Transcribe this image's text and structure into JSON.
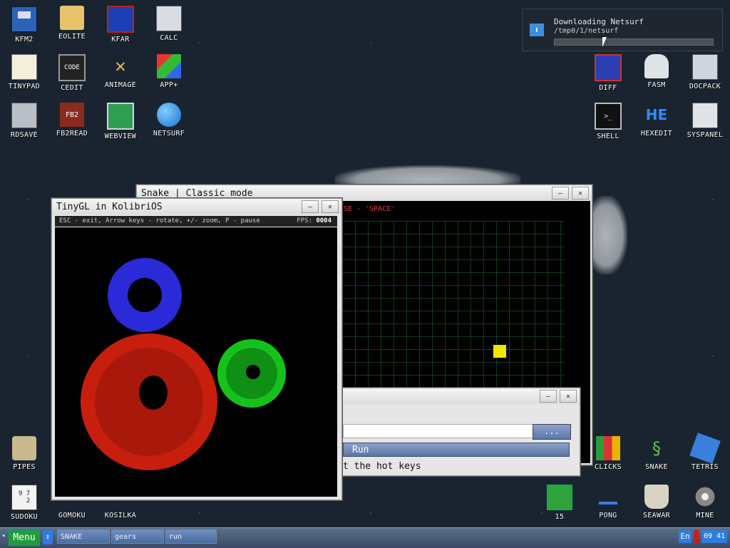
{
  "desktop": {
    "icons": [
      {
        "label": "KFM2"
      },
      {
        "label": "EOLITE"
      },
      {
        "label": "KFAR"
      },
      {
        "label": "CALC"
      },
      {
        "label": "TINYPAD"
      },
      {
        "label": "CEDIT"
      },
      {
        "label": "ANIMAGE"
      },
      {
        "label": "APP+"
      },
      {
        "label": "RDSAVE"
      },
      {
        "label": "FB2READ"
      },
      {
        "label": "WEBVIEW"
      },
      {
        "label": "NETSURF"
      },
      {
        "label": "DIFF"
      },
      {
        "label": "FASM"
      },
      {
        "label": "DOCPACK"
      },
      {
        "label": "SHELL"
      },
      {
        "label": "HEXEDIT"
      },
      {
        "label": "SYSPANEL"
      },
      {
        "label": "PIPES"
      },
      {
        "label": "SUDOKU"
      },
      {
        "label": "GOMOKU"
      },
      {
        "label": "KOSILKA"
      },
      {
        "label": "CLICKS"
      },
      {
        "label": "SNAKE"
      },
      {
        "label": "TETRIS"
      },
      {
        "label": "15"
      },
      {
        "label": "PONG"
      },
      {
        "label": "SEAWAR"
      },
      {
        "label": "MINE"
      }
    ],
    "icon_glyphs": {
      "cedit": "CODE",
      "fb2read": "FB2",
      "hexedit": "HE",
      "sudoku": "9 7\n  2"
    }
  },
  "notification": {
    "title": "Downloading Netsurf",
    "path": "/tmp0/1/netsurf",
    "progress": 0
  },
  "snake_window": {
    "title": "Snake | Classic mode",
    "hint": "SE - 'SPACE'"
  },
  "tinygl_window": {
    "title": "TinyGL in KolibriOS",
    "help": "ESC - exit, Arrow keys - rotate, +/- zoom, P - pause",
    "fps_label": "FPS:",
    "fps_value": "0004"
  },
  "run_window": {
    "browse_label": "...",
    "run_label": "Run",
    "hint": "t the hot keys",
    "input_value": ""
  },
  "taskbar": {
    "menu_label": "Menu",
    "tasks": [
      {
        "label": "SNAKE"
      },
      {
        "label": "gears"
      },
      {
        "label": "run"
      }
    ],
    "lang": "En",
    "time": "09 41"
  },
  "colors": {
    "accent": "#4a6c9e",
    "menu_green": "#1f9d3a",
    "gear_red": "#c81e0e",
    "gear_blue": "#2a2ad8",
    "gear_green": "#15c21c",
    "snake_food": "#f1e600"
  }
}
